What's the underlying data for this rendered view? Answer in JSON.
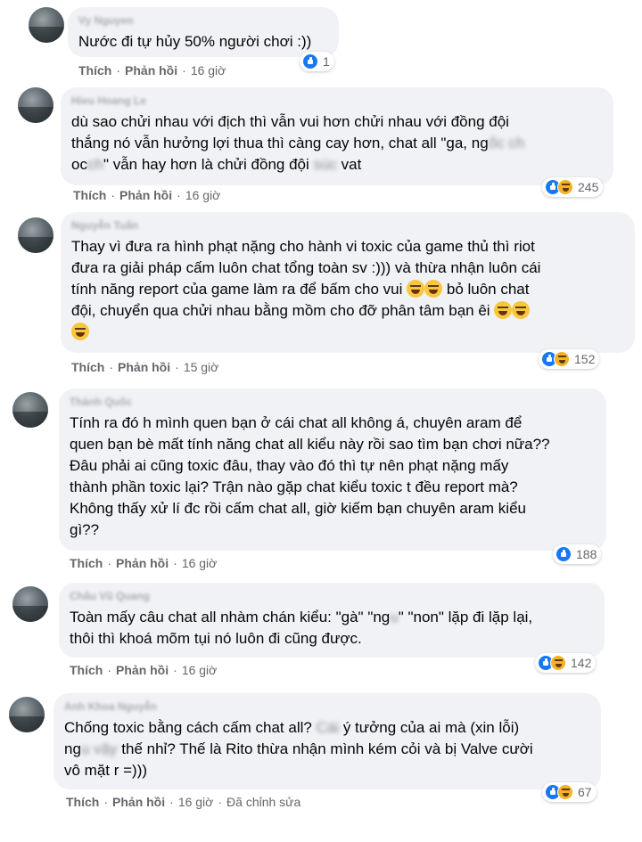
{
  "comments": [
    {
      "author": "Vy Nguyen",
      "text": [
        "Nước đi tự hủy 50% người chơi :))"
      ],
      "like": "Thích",
      "reply": "Phản hồi",
      "time": "16 giờ",
      "reaction_count": "1"
    },
    {
      "author": "Hieu Hoang Le",
      "text": [
        "dù sao chửi nhau với địch thì vẫn vui hơn chửi nhau với đồng đội",
        "thắng nó vẫn hưởng lợi thua thì càng cay hơn, chat all \"ga, ng",
        "oc",
        "\" vẫn hay hơn là chửi đồng đội ",
        " vat"
      ],
      "like": "Thích",
      "reply": "Phản hồi",
      "time": "16 giờ",
      "reaction_count": "245"
    },
    {
      "author": "Nguyễn Tuấn",
      "text": [
        "Thay vì đưa ra hình phạt nặng cho hành vi toxic của game thủ thì riot",
        "đưa ra giải pháp cấm luôn chat tổng toàn sv :))) và thừa nhận luôn cái",
        "tính năng report của game làm ra để bấm cho vui",
        "bỏ luôn chat",
        "đội, chuyển qua chửi nhau bằng mồm cho đỡ phân tâm bạn êi"
      ],
      "like": "Thích",
      "reply": "Phản hồi",
      "time": "15 giờ",
      "reaction_count": "152"
    },
    {
      "author": "Thành Quốc",
      "text": [
        "Tính ra đó h mình quen bạn ở cái chat all không á, chuyên aram để",
        "quen bạn bè mất tính năng chat all kiểu này rồi sao tìm bạn chơi nữa??",
        "Đâu phải ai cũng toxic đâu, thay vào đó thì tự nên phạt nặng mấy",
        "thành phần toxic lại? Trận nào gặp chat kiểu toxic t đều report mà?",
        "Không thấy xử lí đc rồi cấm chat all, giờ kiếm bạn chuyên aram kiểu",
        "gì??"
      ],
      "like": "Thích",
      "reply": "Phản hồi",
      "time": "16 giờ",
      "reaction_count": "188"
    },
    {
      "author": "Châu Vũ Quang",
      "text": [
        "Toàn mấy câu chat all nhàm chán kiểu: \"gà\" \"ng",
        "\" \"non\" lặp đi lặp lại,",
        "thôi thì khoá mõm tụi nó luôn đi cũng được."
      ],
      "like": "Thích",
      "reply": "Phản hồi",
      "time": "16 giờ",
      "reaction_count": "142"
    },
    {
      "author": "Anh Khoa Nguyễn",
      "text": [
        "Chống toxic bằng cách cấm chat all?",
        "ý tưởng của ai mà (xin lỗi)",
        "ng",
        "thế nhỉ? Thế là Rito thừa nhận mình kém cỏi và bị Valve cười",
        "vô mặt r =)))"
      ],
      "like": "Thích",
      "reply": "Phản hồi",
      "time": "16 giờ",
      "edited": "Đã chỉnh sửa",
      "reaction_count": "67"
    }
  ],
  "colors": {
    "bubble": "#f0f2f5",
    "meta": "#65676b",
    "like_blue": "#1877f2",
    "haha_yellow": "#f7b125"
  }
}
